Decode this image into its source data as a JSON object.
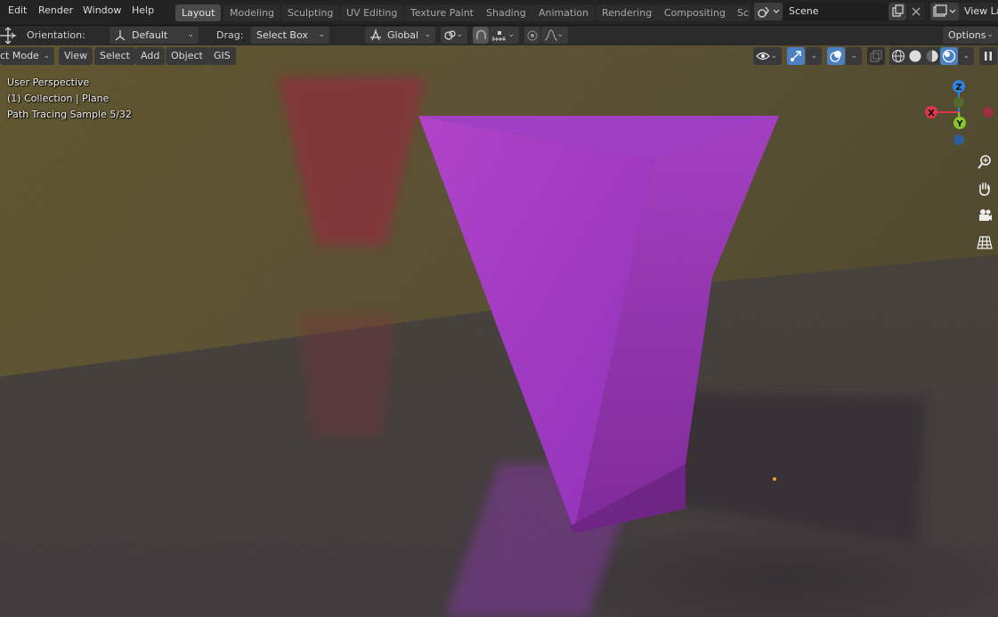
{
  "menu": [
    "Edit",
    "Render",
    "Window",
    "Help"
  ],
  "workspaces": [
    "Layout",
    "Modeling",
    "Sculpting",
    "UV Editing",
    "Texture Paint",
    "Shading",
    "Animation",
    "Rendering",
    "Compositing",
    "Sc"
  ],
  "active_workspace": "Layout",
  "scene": {
    "name": "Scene"
  },
  "view_layer": {
    "label": "View La"
  },
  "toolheader": {
    "orientation_label": "Orientation:",
    "orientation_value": "Default",
    "drag_label": "Drag:",
    "drag_value": "Select Box",
    "transform_orientation": "Global",
    "options_label": "Options"
  },
  "viewport": {
    "mode": "ct Mode",
    "menus": [
      "View",
      "Select",
      "Add",
      "Object",
      "GIS"
    ],
    "overlay": {
      "perspective": "User Perspective",
      "collection": "(1) Collection | Plane",
      "render_status": "Path Tracing Sample 5/32"
    },
    "gizmo": {
      "x": "X",
      "y": "Y",
      "z": "Z"
    }
  },
  "colors": {
    "accent": "#4a7fc1",
    "gizmo_x": "#e0354e",
    "gizmo_y": "#8ac628",
    "gizmo_z": "#2e84e0",
    "object": "#a53acb",
    "wall": "#59531f"
  }
}
